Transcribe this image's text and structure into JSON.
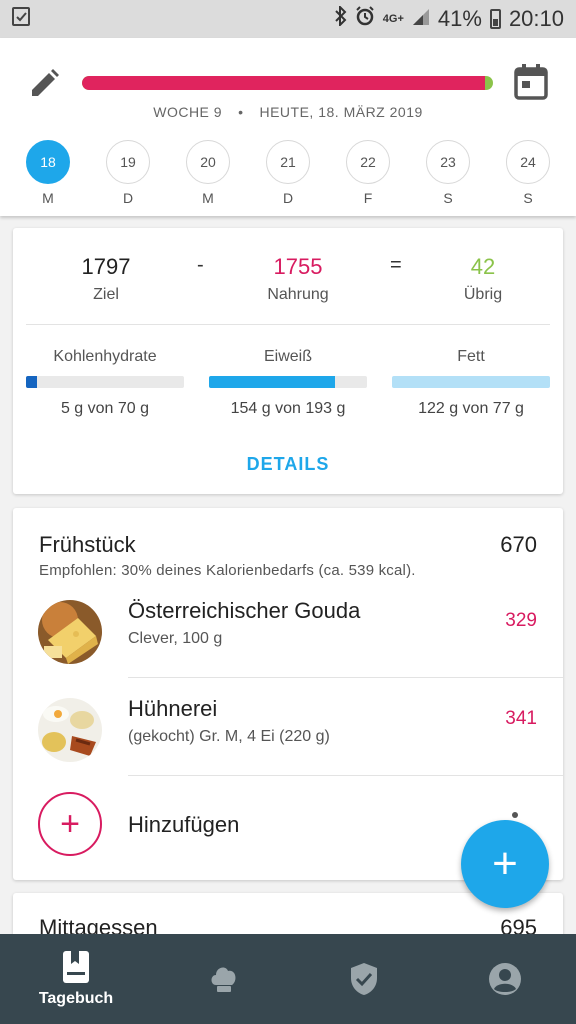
{
  "status_bar": {
    "network": "4G+",
    "battery": "41%",
    "time": "20:10"
  },
  "header": {
    "calorie_progress": 0.98,
    "week": "WOCHE 9",
    "separator": "•",
    "today": "HEUTE, 18. MÄRZ 2019",
    "days": [
      {
        "num": "18",
        "wd": "M",
        "active": true
      },
      {
        "num": "19",
        "wd": "D",
        "active": false
      },
      {
        "num": "20",
        "wd": "M",
        "active": false
      },
      {
        "num": "21",
        "wd": "D",
        "active": false
      },
      {
        "num": "22",
        "wd": "F",
        "active": false
      },
      {
        "num": "23",
        "wd": "S",
        "active": false
      },
      {
        "num": "24",
        "wd": "S",
        "active": false
      }
    ]
  },
  "summary": {
    "goal": {
      "value": "1797",
      "label": "Ziel"
    },
    "minus": "-",
    "food": {
      "value": "1755",
      "label": "Nahrung"
    },
    "equals": "=",
    "remaining": {
      "value": "42",
      "label": "Übrig"
    },
    "macros": [
      {
        "name": "Kohlenhydrate",
        "amount": "5 g von 70 g",
        "progress": 0.07,
        "color": "#1565c0"
      },
      {
        "name": "Eiweiß",
        "amount": "154 g von 193 g",
        "progress": 0.8,
        "color": "#1ea7ea"
      },
      {
        "name": "Fett",
        "amount": "122 g von 77 g",
        "progress": 1.0,
        "color": "#b3e0f7"
      }
    ],
    "details_label": "DETAILS"
  },
  "breakfast": {
    "title": "Frühstück",
    "kcal": "670",
    "hint": "Empfohlen: 30% deines Kalorienbedarfs (ca. 539 kcal).",
    "items": [
      {
        "name": "Österreichischer Gouda",
        "sub": "Clever, 100 g",
        "kcal": "329"
      },
      {
        "name": "Hühnerei",
        "sub": "(gekocht) Gr. M, 4 Ei (220 g)",
        "kcal": "341"
      }
    ],
    "add_label": "Hinzufügen",
    "add_symbol": "+"
  },
  "lunch": {
    "title": "Mittagessen",
    "kcal": "695"
  },
  "fab_symbol": "+",
  "nav": {
    "diary_label": "Tagebuch"
  },
  "colors": {
    "accent": "#1ea7ea",
    "calories": "#d81b60",
    "remaining": "#8bc34a",
    "nav_bg": "#37474f"
  }
}
